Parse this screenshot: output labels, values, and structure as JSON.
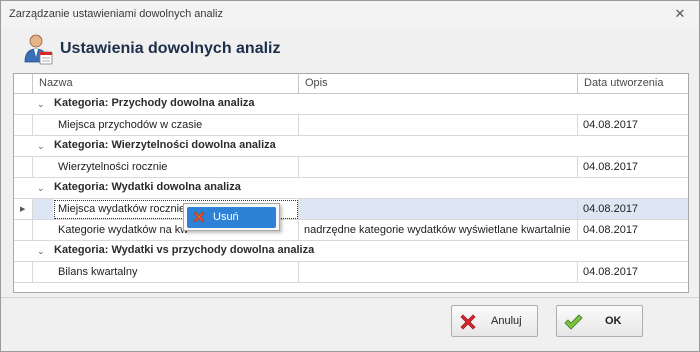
{
  "window": {
    "title": "Zarządzanie ustawieniami dowolnych analiz",
    "close_glyph": "✕"
  },
  "header": {
    "title": "Ustawienia dowolnych analiz",
    "icon": "user-settings-icon"
  },
  "grid": {
    "columns": [
      "Nazwa",
      "Opis",
      "Data utworzenia"
    ],
    "groups": [
      {
        "label": "Kategoria: Przychody dowolna analiza",
        "rows": [
          {
            "name": "Miejsca przychodów w czasie",
            "description": "",
            "date": "04.08.2017"
          }
        ]
      },
      {
        "label": "Kategoria: Wierzytelności dowolna analiza",
        "rows": [
          {
            "name": "Wierzytelności rocznie",
            "description": "",
            "date": "04.08.2017"
          }
        ]
      },
      {
        "label": "Kategoria: Wydatki dowolna analiza",
        "rows": [
          {
            "name": "Miejsca wydatków rocznie",
            "description": "",
            "date": "04.08.2017",
            "selected": true
          },
          {
            "name": "Kategorie wydatków na kw",
            "description": "nadrzędne kategorie wydatków wyświetlane kwartalnie",
            "date": "04.08.2017"
          }
        ]
      },
      {
        "label": "Kategoria: Wydatki vs przychody dowolna analiza",
        "rows": [
          {
            "name": "Bilans kwartalny",
            "description": "",
            "date": "04.08.2017"
          }
        ]
      }
    ]
  },
  "context_menu": {
    "items": [
      {
        "label": "Usuń",
        "icon": "delete-x-icon"
      }
    ]
  },
  "buttons": {
    "cancel_label": "Anuluj",
    "ok_label": "OK"
  },
  "colors": {
    "selection": "#dde7f4",
    "menu_highlight": "#2d82d6",
    "header_text": "#1d2f4a",
    "cancel_icon": "#d9262c",
    "ok_icon": "#5aa02c"
  }
}
